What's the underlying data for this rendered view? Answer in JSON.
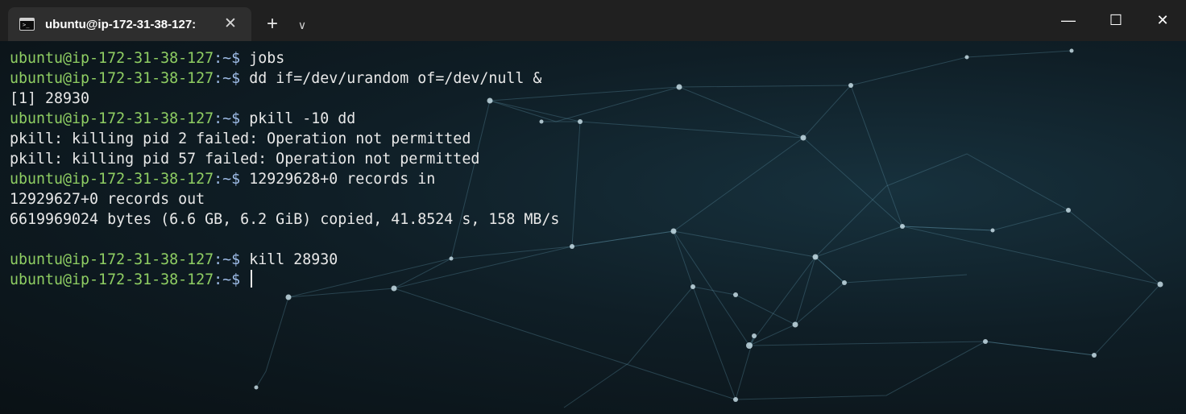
{
  "window": {
    "tab_title": "ubuntu@ip-172-31-38-127:",
    "tab_close": "✕",
    "new_tab": "+",
    "tab_menu": "∨",
    "controls": {
      "minimize": "—",
      "maximize": "☐",
      "close": "✕"
    }
  },
  "terminal": {
    "prompt_user": "ubuntu@ip-172-31-38-127",
    "prompt_sep": ":~$ ",
    "lines": [
      {
        "type": "prompt",
        "cmd": "jobs"
      },
      {
        "type": "prompt",
        "cmd": "dd if=/dev/urandom of=/dev/null &"
      },
      {
        "type": "output",
        "text": "[1] 28930"
      },
      {
        "type": "prompt",
        "cmd": "pkill -10 dd"
      },
      {
        "type": "output",
        "text": "pkill: killing pid 2 failed: Operation not permitted"
      },
      {
        "type": "output",
        "text": "pkill: killing pid 57 failed: Operation not permitted"
      },
      {
        "type": "prompt",
        "cmd": "12929628+0 records in"
      },
      {
        "type": "output",
        "text": "12929627+0 records out"
      },
      {
        "type": "output",
        "text": "6619969024 bytes (6.6 GB, 6.2 GiB) copied, 41.8524 s, 158 MB/s"
      },
      {
        "type": "output",
        "text": ""
      },
      {
        "type": "prompt",
        "cmd": "kill 28930"
      },
      {
        "type": "prompt",
        "cmd": "",
        "cursor": true
      }
    ]
  },
  "colors": {
    "prompt_user": "#8fce63",
    "prompt_path": "#9fbde8",
    "text": "#e8e8e8",
    "titlebar": "#202020"
  }
}
